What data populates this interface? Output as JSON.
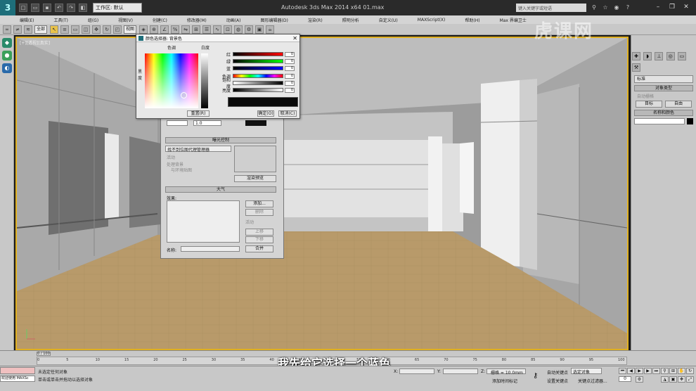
{
  "app": {
    "title": "Autodesk 3ds Max  2014 x64     01.max",
    "workspace": "工作区: 默认",
    "search_placeholder": "键入关键字或短语",
    "viewport_label": "[+][透视][真实]",
    "logo_letter": "3"
  },
  "menu": [
    "编辑(E)",
    "工具(T)",
    "组(G)",
    "视图(V)",
    "创建(C)",
    "修改器(M)",
    "动画(A)",
    "图形编辑器(D)",
    "渲染(R)",
    "照明分析",
    "自定义(U)",
    "MAXScript(X)",
    "帮助(H)",
    "Max 界编卫士"
  ],
  "toolbar": {
    "filter": "全部",
    "view_ref": "视图",
    "select_icon_glyph": "↖"
  },
  "command_panel": {
    "dropdown": "标准",
    "object_type_header": "对象类型",
    "auto_grid": "自动栅格",
    "btn_target": "目标",
    "btn_free": "自由",
    "name_color_header": "名称和颜色"
  },
  "color_picker": {
    "title": "颜色选择器: 背景色",
    "hue_label": "色调",
    "whiteness_label": "白度",
    "blackness_label": "黑\n度",
    "sliders": [
      {
        "label": "红",
        "value": "0"
      },
      {
        "label": "绿",
        "value": "0"
      },
      {
        "label": "蓝",
        "value": "0"
      },
      {
        "label": "色调",
        "value": "0"
      },
      {
        "label": "饱和度",
        "value": "0"
      },
      {
        "label": "亮度",
        "value": "0"
      }
    ],
    "reset": "重置(R)",
    "ok": "确定(O)",
    "cancel": "取消(C)",
    "swatch_color": "#0a0a0a"
  },
  "environment": {
    "level_value": "1.0",
    "exposure_header": "曝光控制",
    "exposure_select": "找不到位图代理管理器",
    "active": "活动",
    "process_bg": "处理背景",
    "and_env_map": "与环境贴图",
    "render_preview": "渲染预览",
    "atmosphere_header": "大气",
    "effects_label": "效果:",
    "add": "添加...",
    "delete": "删除",
    "active2": "活动",
    "move_up": "上移",
    "move_down": "下移",
    "name_label": "名称:",
    "merge": "合并"
  },
  "subtitle": "我先给它选择一个蓝色",
  "watermark": "虎课网",
  "timeline": {
    "slider": "0 / 100",
    "ticks": [
      "0",
      "5",
      "10",
      "15",
      "20",
      "25",
      "30",
      "35",
      "40",
      "45",
      "50",
      "55",
      "60",
      "65",
      "70",
      "75",
      "80",
      "85",
      "90",
      "95",
      "100"
    ]
  },
  "status": {
    "maxscript_label": "欢迎使用 MAXSc",
    "line1": "未选定任何对象",
    "line2": "单击或单击并拖动以选择对象",
    "x_label": "X:",
    "y_label": "Y:",
    "z_label": "Z:",
    "grid": "栅格 = 10.0mm",
    "auto_key": "自动关键点",
    "selected": "选定对象",
    "set_key": "设置关键点",
    "key_filters": "关键点过滤器...",
    "add_time_tag": "添加时间标记",
    "frame": "0"
  },
  "colors": {
    "viewport_border": "#e0b020",
    "floor": "#b89a6a"
  }
}
